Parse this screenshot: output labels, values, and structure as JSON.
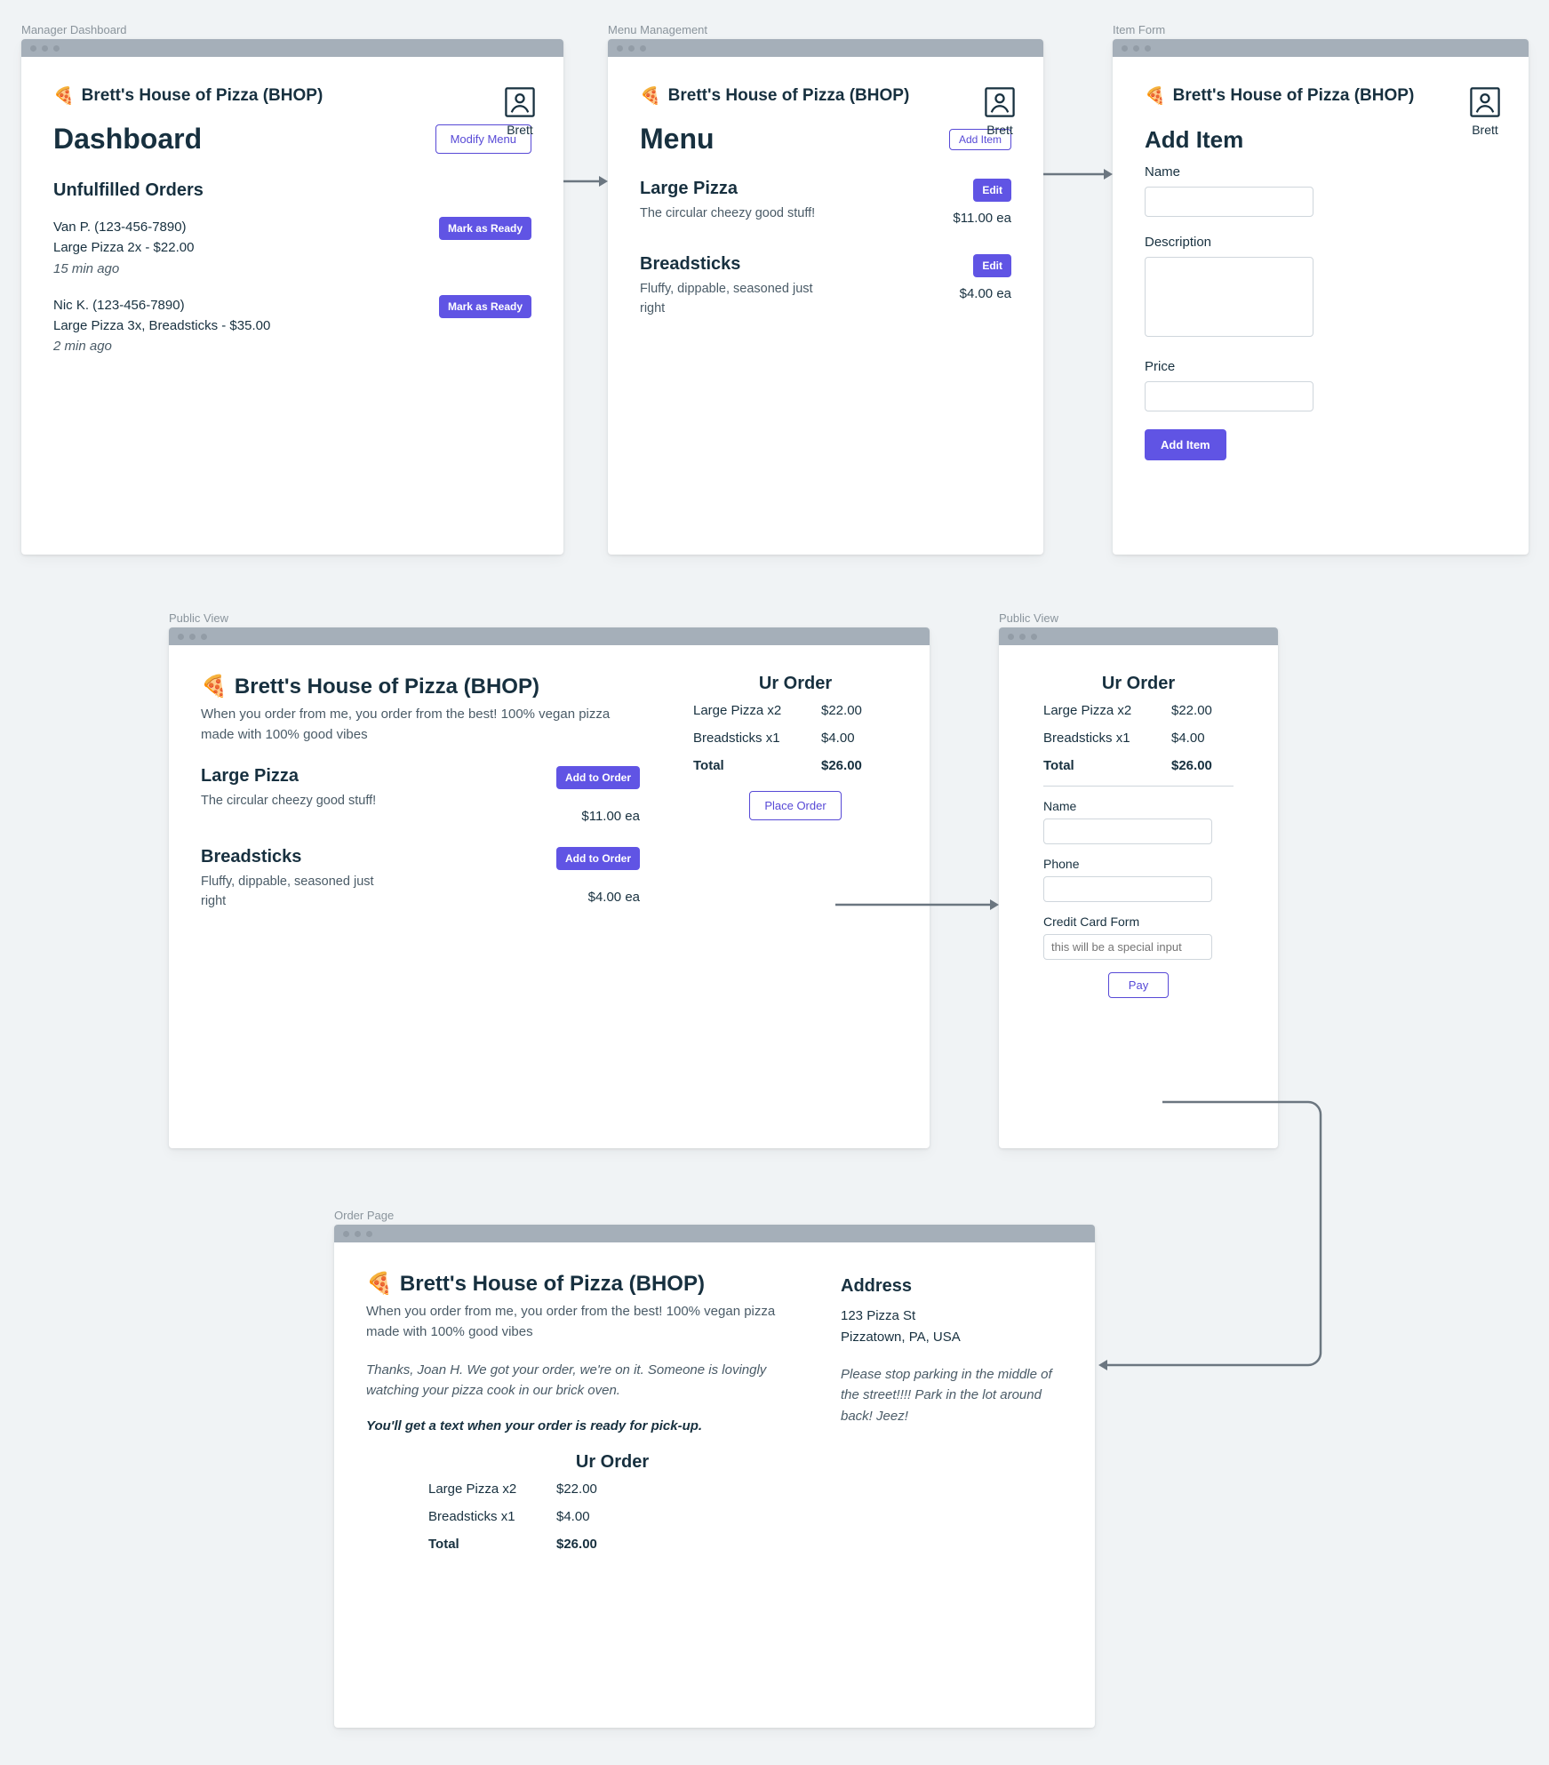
{
  "brand": "Brett's House of Pizza (BHOP)",
  "user": "Brett",
  "tagline": "When you order from me, you order from the best! 100% vegan pizza made with 100% good vibes",
  "dashboard": {
    "caption": "Manager Dashboard",
    "title": "Dashboard",
    "modify": "Modify Menu",
    "section": "Unfulfilled Orders",
    "mark": "Mark as Ready",
    "orders": [
      {
        "line1": "Van P. (123-456-7890)",
        "line2": "Large Pizza 2x - $22.00",
        "ago": "15 min ago"
      },
      {
        "line1": "Nic K. (123-456-7890)",
        "line2": "Large Pizza 3x, Breadsticks - $35.00",
        "ago": "2 min ago"
      }
    ]
  },
  "menu": {
    "caption": "Menu Management",
    "title": "Menu",
    "add": "Add Item",
    "edit": "Edit",
    "items": [
      {
        "name": "Large Pizza",
        "desc": "The circular cheezy good stuff!",
        "price": "$11.00 ea"
      },
      {
        "name": "Breadsticks",
        "desc": "Fluffy, dippable, seasoned just right",
        "price": "$4.00 ea"
      }
    ]
  },
  "itemform": {
    "caption": "Item Form",
    "title": "Add Item",
    "lbl_name": "Name",
    "lbl_desc": "Description",
    "lbl_price": "Price",
    "submit": "Add Item"
  },
  "public": {
    "caption": "Public View",
    "add": "Add to Order",
    "items": [
      {
        "name": "Large Pizza",
        "desc": "The circular cheezy good stuff!",
        "price": "$11.00 ea"
      },
      {
        "name": "Breadsticks",
        "desc": "Fluffy, dippable, seasoned just right",
        "price": "$4.00 ea"
      }
    ],
    "order_title": "Ur Order",
    "lines": [
      {
        "label": "Large Pizza x2",
        "amt": "$22.00"
      },
      {
        "label": "Breadsticks x1",
        "amt": "$4.00"
      }
    ],
    "total_label": "Total",
    "total_amt": "$26.00",
    "place": "Place Order"
  },
  "checkout": {
    "caption": "Public View",
    "lbl_name": "Name",
    "lbl_phone": "Phone",
    "lbl_cc": "Credit Card Form",
    "cc_ph": "this will be a special input",
    "pay": "Pay"
  },
  "confirm": {
    "caption": "Order Page",
    "thanks": "Thanks, Joan H. We got your order, we're on it. Someone is lovingly watching your pizza cook in our brick oven.",
    "pickup": "You'll get a text when your order is ready for pick-up.",
    "addr_title": "Address",
    "addr1": "123 Pizza St",
    "addr2": "Pizzatown, PA, USA",
    "addr_note": "Please stop parking in the middle of the street!!!! Park in the lot around back! Jeez!"
  }
}
